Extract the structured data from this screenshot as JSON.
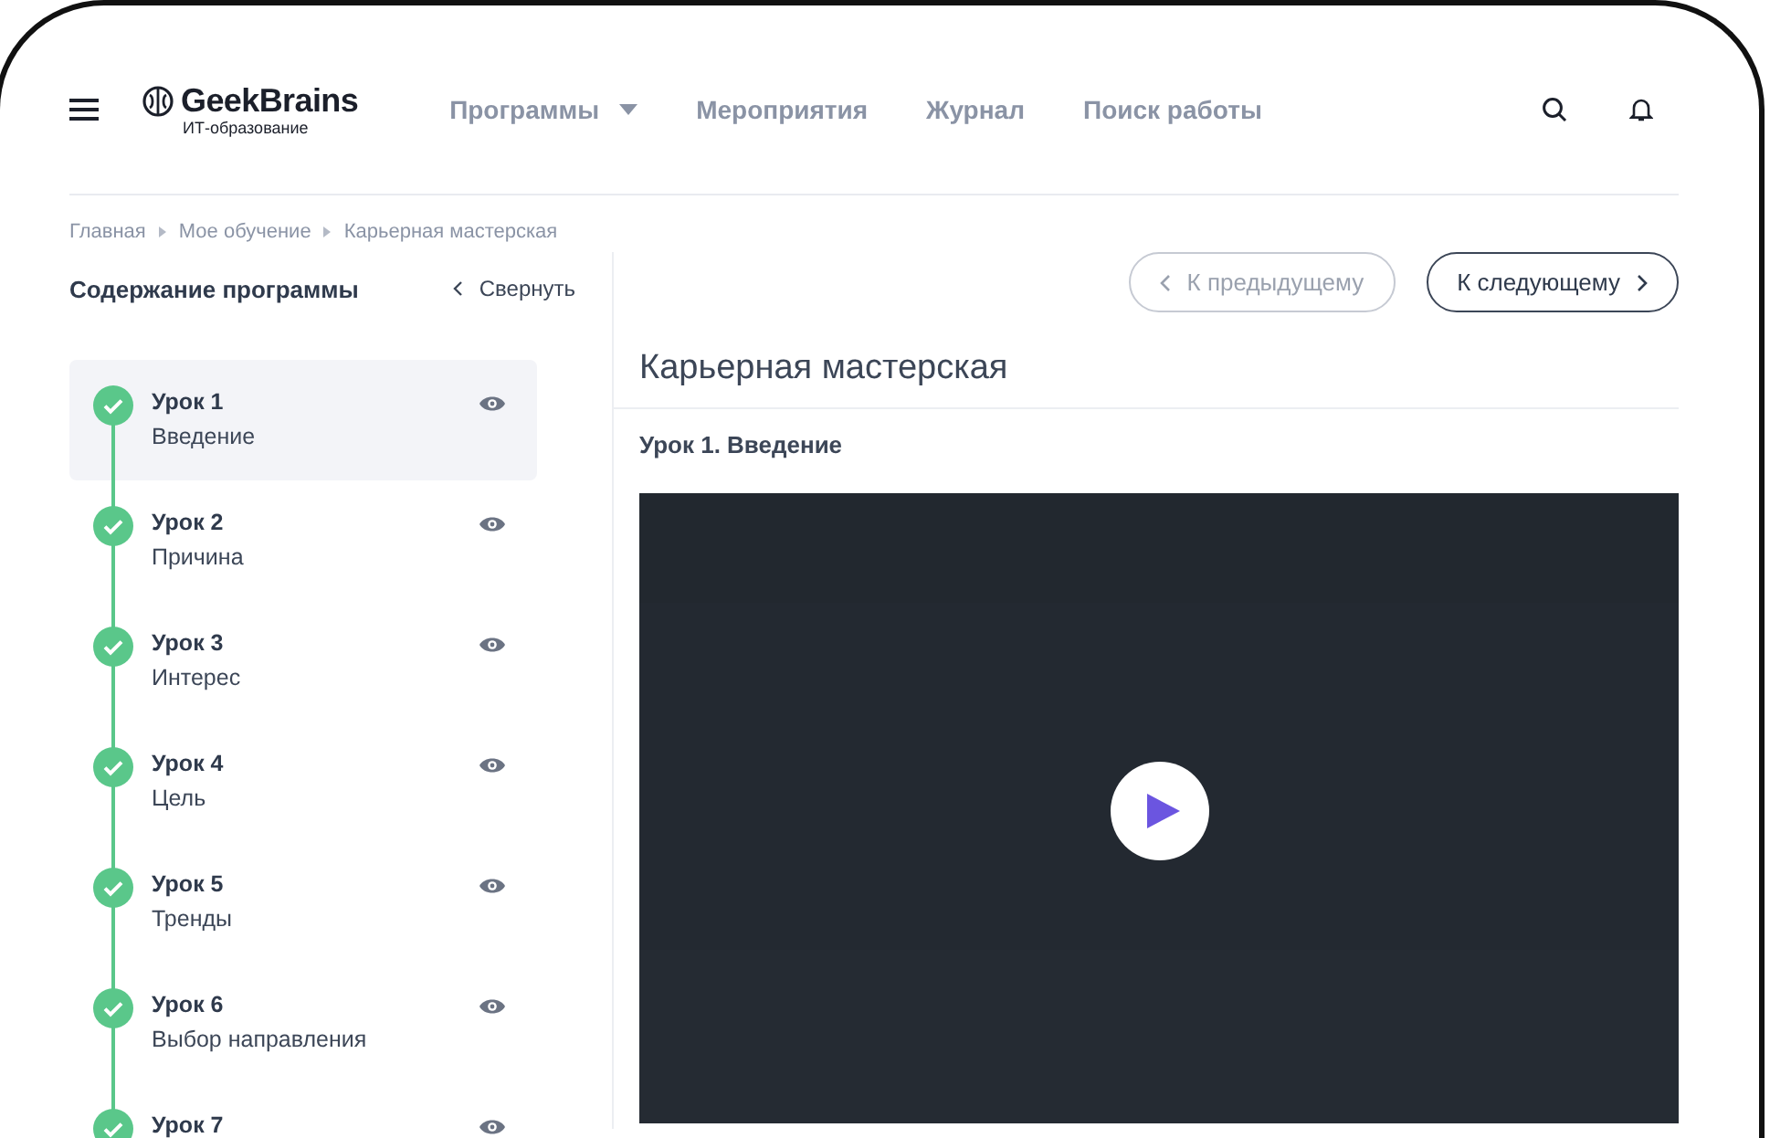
{
  "header": {
    "logo": "GeekBrains",
    "logo_sub": "ИТ-образование",
    "nav": [
      {
        "label": "Программы",
        "kind": "dropdown"
      },
      {
        "label": "Мероприятия",
        "kind": "link"
      },
      {
        "label": "Журнал",
        "kind": "link"
      },
      {
        "label": "Поиск работы",
        "kind": "link"
      }
    ]
  },
  "breadcrumbs": [
    "Главная",
    "Мое обучение",
    "Карьерная мастерская"
  ],
  "sidebar": {
    "title": "Содержание программы",
    "collapse": "Свернуть",
    "lessons": [
      {
        "title": "Урок 1",
        "subtitle": "Введение",
        "done": true,
        "selected": true
      },
      {
        "title": "Урок 2",
        "subtitle": "Причина",
        "done": true,
        "selected": false
      },
      {
        "title": "Урок 3",
        "subtitle": "Интерес",
        "done": true,
        "selected": false
      },
      {
        "title": "Урок 4",
        "subtitle": "Цель",
        "done": true,
        "selected": false
      },
      {
        "title": "Урок 5",
        "subtitle": "Тренды",
        "done": true,
        "selected": false
      },
      {
        "title": "Урок 6",
        "subtitle": "Выбор направления",
        "done": true,
        "selected": false
      },
      {
        "title": "Урок 7",
        "done": true,
        "selected": false
      }
    ]
  },
  "pager": {
    "prev": {
      "label": "К предыдущему",
      "disabled": true
    },
    "next": {
      "label": "К следующему",
      "disabled": false
    }
  },
  "course_title": "Карьерная мастерская",
  "lesson_title": "Урок 1. Введение",
  "video": {
    "kind": "picture"
  }
}
